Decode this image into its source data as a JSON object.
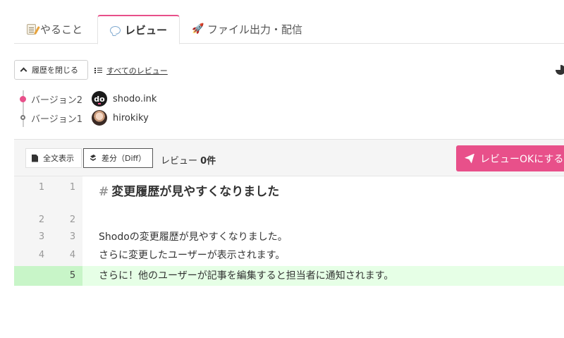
{
  "tabs": [
    {
      "label": "やること",
      "icon": "memo-icon"
    },
    {
      "label": "レビュー",
      "icon": "speech-bubble-icon",
      "active": true
    },
    {
      "label": "ファイル出力・配信",
      "icon": "rocket-icon"
    }
  ],
  "toolbar": {
    "close_history_label": "履歴を閉じる",
    "all_reviews_label": "すべてのレビュー"
  },
  "versions": [
    {
      "label": "バージョン2",
      "user": "shodo.ink",
      "avatar_text": "do",
      "current": true
    },
    {
      "label": "バージョン1",
      "user": "hirokiky",
      "current": false
    }
  ],
  "diff_toolbar": {
    "full_view_label": "全文表示",
    "diff_label": "差分（Diff）",
    "review_label": "レビュー",
    "review_count": "0件",
    "ok_button_label": "レビューOKにする"
  },
  "diff_lines": [
    {
      "old": "1",
      "new": "1",
      "hash": "#",
      "text": "変更履歴が見やすくなりました"
    },
    {
      "old": "2",
      "new": "2",
      "text": ""
    },
    {
      "old": "3",
      "new": "3",
      "text": "Shodoの変更履歴が見やすくなりました。"
    },
    {
      "old": "4",
      "new": "4",
      "text": "さらに変更したユーザーが表示されます。"
    },
    {
      "old": "",
      "new": "5",
      "text": "さらに！他のユーザーが記事を編集すると担当者に通知されます。",
      "added": true
    }
  ],
  "colors": {
    "accent": "#e8508a",
    "added_line_bg": "#e6ffe6",
    "added_gutter_bg": "#c8f5c8"
  }
}
